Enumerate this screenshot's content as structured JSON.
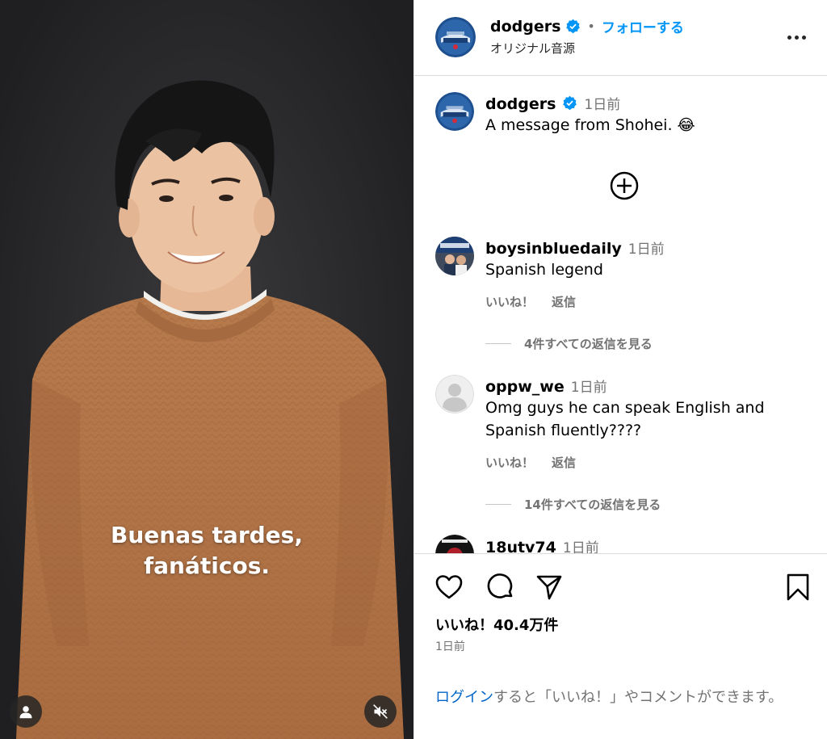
{
  "video": {
    "subtitle_line1": "Buenas tardes,",
    "subtitle_line2": "fanáticos.",
    "user_tag_icon": "person-icon",
    "mute_icon": "speaker-muted-icon"
  },
  "header": {
    "username": "dodgers",
    "verified_icon": "verified-badge-icon",
    "separator": "•",
    "follow_label": "フォローする",
    "audio_label": "オリジナル音源",
    "more_icon": "more-options-icon"
  },
  "caption": {
    "username": "dodgers",
    "time": "1日前",
    "text": "A message from Shohei. 😂"
  },
  "load_more_icon": "plus-circle-icon",
  "comments": [
    {
      "username": "boysinbluedaily",
      "time": "1日前",
      "text": "Spanish legend",
      "like_label": "いいね！",
      "reply_label": "返信",
      "view_replies": "4件すべての返信を見る"
    },
    {
      "username": "oppw_we",
      "time": "1日前",
      "text": "Omg guys he can speak English and Spanish fluently????",
      "like_label": "いいね！",
      "reply_label": "返信",
      "view_replies": "14件すべての返信を見る"
    },
    {
      "username": "18utv74",
      "time": "1日前"
    }
  ],
  "footer": {
    "like_icon": "heart-icon",
    "comment_icon": "comment-icon",
    "share_icon": "share-icon",
    "save_icon": "bookmark-icon",
    "likes_text": "いいね！40.4万件",
    "posted_time": "1日前",
    "login_link": "ログイン",
    "login_rest": "すると「いいね！」やコメントができます。"
  },
  "colors": {
    "follow_blue": "#0095f6",
    "link_blue": "#0064c8",
    "secondary_text": "#737373",
    "dodgers_blue": "#1e4f8f"
  }
}
